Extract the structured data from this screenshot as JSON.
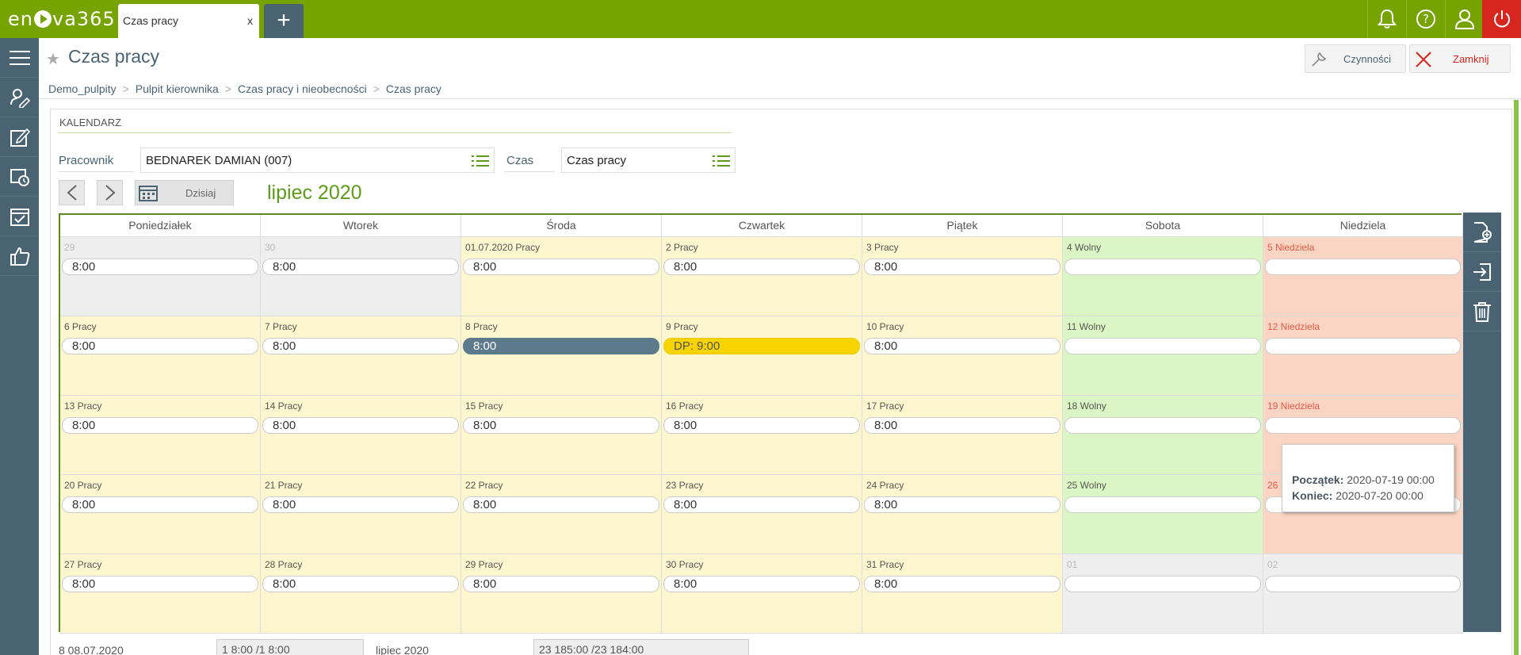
{
  "app": {
    "logo": "en va365"
  },
  "tabs": [
    {
      "label": "Czas pracy",
      "close": "x"
    }
  ],
  "add_tab": "+",
  "header": {
    "title": "Czas pracy",
    "actions_label": "Czynności",
    "close_label": "Zamknij"
  },
  "breadcrumb": [
    "Demo_pulpity",
    "Pulpit kierownika",
    "Czas pracy i nieobecności",
    "Czas pracy"
  ],
  "section": {
    "title": "KALENDARZ"
  },
  "filters": {
    "employee_label": "Pracownik",
    "employee_value": "BEDNAREK DAMIAN (007)",
    "time_label": "Czas",
    "time_value": "Czas pracy"
  },
  "nav": {
    "today_label": "Dzisiaj",
    "month": "lipiec 2020"
  },
  "weekdays": [
    "Poniedziałek",
    "Wtorek",
    "Środa",
    "Czwartek",
    "Piątek",
    "Sobota",
    "Niedziela"
  ],
  "weeks": [
    [
      {
        "label": "29",
        "value": "8:00",
        "kind": "out"
      },
      {
        "label": "30",
        "value": "8:00",
        "kind": "out"
      },
      {
        "label": "01.07.2020 Pracy",
        "value": "8:00",
        "kind": "work"
      },
      {
        "label": "2 Pracy",
        "value": "8:00",
        "kind": "work"
      },
      {
        "label": "3 Pracy",
        "value": "8:00",
        "kind": "work"
      },
      {
        "label": "4 Wolny",
        "value": "",
        "kind": "free"
      },
      {
        "label": "5 Niedziela",
        "value": "",
        "kind": "sun"
      }
    ],
    [
      {
        "label": "6 Pracy",
        "value": "8:00",
        "kind": "work"
      },
      {
        "label": "7 Pracy",
        "value": "8:00",
        "kind": "work"
      },
      {
        "label": "8 Pracy",
        "value": "8:00",
        "kind": "work",
        "state": "selected"
      },
      {
        "label": "9 Pracy",
        "value": "DP: 9:00",
        "kind": "work",
        "state": "dp"
      },
      {
        "label": "10 Pracy",
        "value": "8:00",
        "kind": "work"
      },
      {
        "label": "11 Wolny",
        "value": "",
        "kind": "free"
      },
      {
        "label": "12 Niedziela",
        "value": "",
        "kind": "sun"
      }
    ],
    [
      {
        "label": "13 Pracy",
        "value": "8:00",
        "kind": "work"
      },
      {
        "label": "14 Pracy",
        "value": "8:00",
        "kind": "work"
      },
      {
        "label": "15 Pracy",
        "value": "8:00",
        "kind": "work"
      },
      {
        "label": "16 Pracy",
        "value": "8:00",
        "kind": "work"
      },
      {
        "label": "17 Pracy",
        "value": "8:00",
        "kind": "work"
      },
      {
        "label": "18 Wolny",
        "value": "",
        "kind": "free"
      },
      {
        "label": "19 Niedziela",
        "value": "",
        "kind": "sun"
      }
    ],
    [
      {
        "label": "20 Pracy",
        "value": "8:00",
        "kind": "work"
      },
      {
        "label": "21 Pracy",
        "value": "8:00",
        "kind": "work"
      },
      {
        "label": "22 Pracy",
        "value": "8:00",
        "kind": "work"
      },
      {
        "label": "23 Pracy",
        "value": "8:00",
        "kind": "work"
      },
      {
        "label": "24 Pracy",
        "value": "8:00",
        "kind": "work"
      },
      {
        "label": "25 Wolny",
        "value": "",
        "kind": "free"
      },
      {
        "label": "26",
        "value": "",
        "kind": "sun"
      }
    ],
    [
      {
        "label": "27 Pracy",
        "value": "8:00",
        "kind": "work"
      },
      {
        "label": "28 Pracy",
        "value": "8:00",
        "kind": "work"
      },
      {
        "label": "29 Pracy",
        "value": "8:00",
        "kind": "work"
      },
      {
        "label": "30 Pracy",
        "value": "8:00",
        "kind": "work"
      },
      {
        "label": "31 Pracy",
        "value": "8:00",
        "kind": "work"
      },
      {
        "label": "01",
        "value": "",
        "kind": "out"
      },
      {
        "label": "02",
        "value": "",
        "kind": "out"
      }
    ]
  ],
  "tooltip": {
    "start_label": "Początek:",
    "start_value": "2020-07-19 00:00",
    "end_label": "Koniec:",
    "end_value": "2020-07-20 00:00"
  },
  "footer": {
    "day_info": "8   08.07.2020",
    "day_values": "1  8:00 /1  8:00",
    "month_info": "lipiec 2020",
    "month_values": "23  185:00 /23  184:00"
  },
  "colors": {
    "brand": "#76a300",
    "sidebar": "#4a6373",
    "power": "#d7261e",
    "work": "#fdf6cf",
    "free": "#dcf5c4",
    "sunday": "#fbd5c3"
  },
  "icons": [
    "bell-icon",
    "help-icon",
    "user-icon",
    "power-icon",
    "menu-icon",
    "wrench-icon",
    "close-icon",
    "star-icon",
    "list-icon",
    "chevron-left-icon",
    "chevron-right-icon",
    "calendar-icon",
    "add-document-icon",
    "login-icon",
    "trash-icon"
  ]
}
